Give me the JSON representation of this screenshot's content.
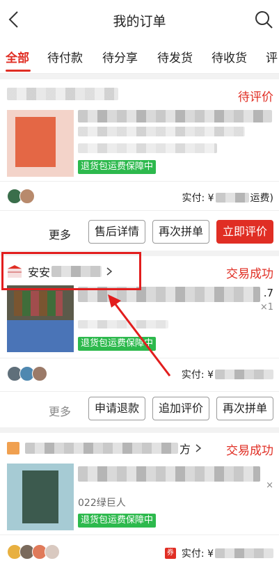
{
  "header": {
    "title": "我的订单"
  },
  "tabs": [
    "全部",
    "待付款",
    "待分享",
    "待发货",
    "待收货",
    "评"
  ],
  "orders": [
    {
      "status": "待评价",
      "badge": "退货包运费保障中",
      "pay_label": "实付: ¥",
      "pay_tail": "运费)",
      "buttons": [
        "更多",
        "售后详情",
        "再次拼单",
        "立即评价"
      ]
    },
    {
      "shop": "安安",
      "status": "交易成功",
      "price_tail": ".7",
      "qty": "×1",
      "badge": "退货包运费保障中",
      "pay_label": "实付: ¥",
      "buttons": [
        "更多",
        "申请退款",
        "追加评价",
        "再次拼单"
      ]
    },
    {
      "shop_tail": "方",
      "status": "交易成功",
      "subtitle": "022绿巨人",
      "qty": "×",
      "badge": "退货包运费保障中",
      "coupon": "券",
      "pay_label": "实付: ¥"
    }
  ],
  "colors": {
    "accent": "#e02e24",
    "badge": "#2db94d",
    "annotation": "#e21d1d"
  }
}
